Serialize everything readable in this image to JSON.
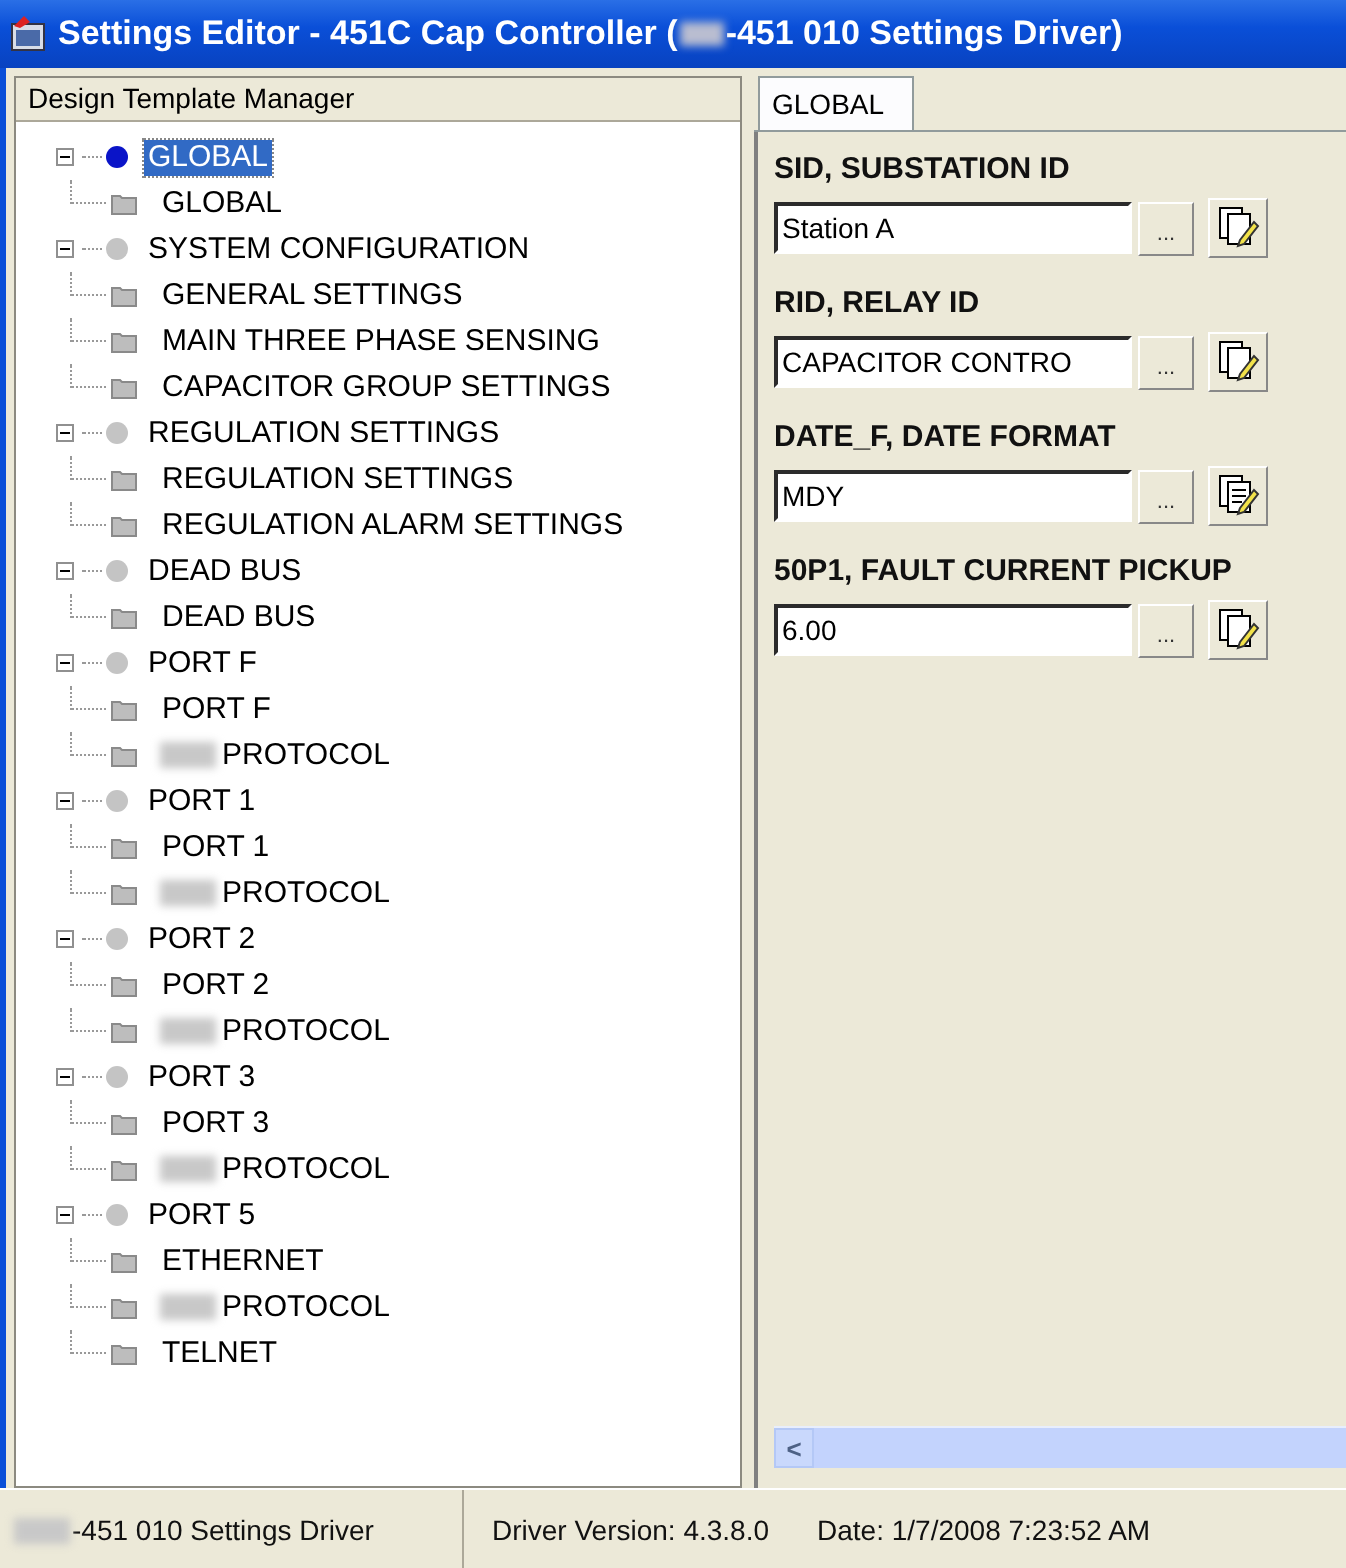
{
  "window": {
    "title_before_redaction": "Settings Editor - 451C Cap Controller (",
    "title_after_redaction": "-451 010 Settings Driver)"
  },
  "tree_panel": {
    "header": "Design Template Manager",
    "items": [
      {
        "label": "GLOBAL",
        "expanded": true,
        "selected": true,
        "color": "#0a14c8",
        "children": [
          {
            "label": "GLOBAL",
            "redacted_prefix": false
          }
        ]
      },
      {
        "label": "SYSTEM CONFIGURATION",
        "expanded": true,
        "selected": false,
        "color": "#c4c4c4",
        "children": [
          {
            "label": "GENERAL SETTINGS",
            "redacted_prefix": false
          },
          {
            "label": "MAIN THREE PHASE SENSING",
            "redacted_prefix": false
          },
          {
            "label": "CAPACITOR GROUP SETTINGS",
            "redacted_prefix": false
          }
        ]
      },
      {
        "label": "REGULATION SETTINGS",
        "expanded": true,
        "selected": false,
        "color": "#c4c4c4",
        "children": [
          {
            "label": "REGULATION SETTINGS",
            "redacted_prefix": false
          },
          {
            "label": "REGULATION ALARM SETTINGS",
            "redacted_prefix": false
          }
        ]
      },
      {
        "label": "DEAD BUS",
        "expanded": true,
        "selected": false,
        "color": "#c4c4c4",
        "children": [
          {
            "label": "DEAD BUS",
            "redacted_prefix": false
          }
        ]
      },
      {
        "label": "PORT F",
        "expanded": true,
        "selected": false,
        "color": "#c4c4c4",
        "children": [
          {
            "label": "PORT F",
            "redacted_prefix": false
          },
          {
            "label": "PROTOCOL",
            "redacted_prefix": true
          }
        ]
      },
      {
        "label": "PORT 1",
        "expanded": true,
        "selected": false,
        "color": "#c4c4c4",
        "children": [
          {
            "label": "PORT 1",
            "redacted_prefix": false
          },
          {
            "label": "PROTOCOL",
            "redacted_prefix": true
          }
        ]
      },
      {
        "label": "PORT 2",
        "expanded": true,
        "selected": false,
        "color": "#c4c4c4",
        "children": [
          {
            "label": "PORT 2",
            "redacted_prefix": false
          },
          {
            "label": "PROTOCOL",
            "redacted_prefix": true
          }
        ]
      },
      {
        "label": "PORT 3",
        "expanded": true,
        "selected": false,
        "color": "#c4c4c4",
        "children": [
          {
            "label": "PORT 3",
            "redacted_prefix": false
          },
          {
            "label": "PROTOCOL",
            "redacted_prefix": true
          }
        ]
      },
      {
        "label": "PORT 5",
        "expanded": true,
        "selected": false,
        "color": "#c4c4c4",
        "children": [
          {
            "label": "ETHERNET",
            "redacted_prefix": false
          },
          {
            "label": "PROTOCOL",
            "redacted_prefix": true
          },
          {
            "label": "TELNET",
            "redacted_prefix": false
          }
        ]
      }
    ]
  },
  "tabs": [
    {
      "label": "GLOBAL",
      "selected": true
    }
  ],
  "settings": [
    {
      "label": "SID, SUBSTATION ID",
      "value": "Station A",
      "browse_button": "...",
      "kind": "pencil"
    },
    {
      "label": "RID, RELAY ID",
      "value": "CAPACITOR CONTRO",
      "browse_button": "...",
      "kind": "pencil"
    },
    {
      "label": "DATE_F, DATE FORMAT",
      "value": "MDY",
      "browse_button": "...",
      "kind": "list"
    },
    {
      "label": "50P1, FAULT CURRENT PICKUP",
      "value": "6.00",
      "browse_button": "...",
      "kind": "pencil"
    }
  ],
  "horizontal_scrollbar": {
    "left_arrow": "<"
  },
  "status_bar": {
    "driver_name_after_redaction": "-451 010 Settings Driver",
    "driver_version": "Driver Version: 4.3.8.0",
    "date": "Date: 1/7/2008 7:23:52 AM"
  }
}
